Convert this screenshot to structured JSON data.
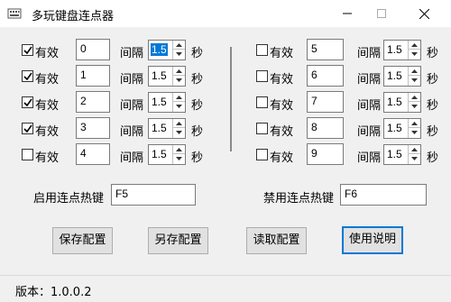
{
  "window": {
    "title": "多玩键盘连点器"
  },
  "labels": {
    "enabled": "有效",
    "interval": "间隔",
    "seconds": "秒"
  },
  "left_rows": [
    {
      "checked": true,
      "key": "0",
      "interval": "1.5",
      "selected": true
    },
    {
      "checked": true,
      "key": "1",
      "interval": "1.5",
      "selected": false
    },
    {
      "checked": true,
      "key": "2",
      "interval": "1.5",
      "selected": false
    },
    {
      "checked": true,
      "key": "3",
      "interval": "1.5",
      "selected": false
    },
    {
      "checked": false,
      "key": "4",
      "interval": "1.5",
      "selected": false
    }
  ],
  "right_rows": [
    {
      "checked": false,
      "key": "5",
      "interval": "1.5"
    },
    {
      "checked": false,
      "key": "6",
      "interval": "1.5"
    },
    {
      "checked": false,
      "key": "7",
      "interval": "1.5"
    },
    {
      "checked": false,
      "key": "8",
      "interval": "1.5"
    },
    {
      "checked": false,
      "key": "9",
      "interval": "1.5"
    }
  ],
  "hotkeys": {
    "enable_label": "启用连点热键",
    "enable_value": "F5",
    "disable_label": "禁用连点热键",
    "disable_value": "F6"
  },
  "buttons": {
    "save": "保存配置",
    "save_as": "另存配置",
    "load": "读取配置",
    "help": "使用说明"
  },
  "status": {
    "version": "版本：1.0.0.2"
  },
  "icons": {
    "app": "keyboard-app-icon",
    "minimize": "minimize-icon",
    "maximize": "maximize-icon",
    "close": "close-icon",
    "check": "checkmark-icon"
  },
  "colors": {
    "accent": "#0078d7",
    "window_bg": "#f0f0f0"
  }
}
